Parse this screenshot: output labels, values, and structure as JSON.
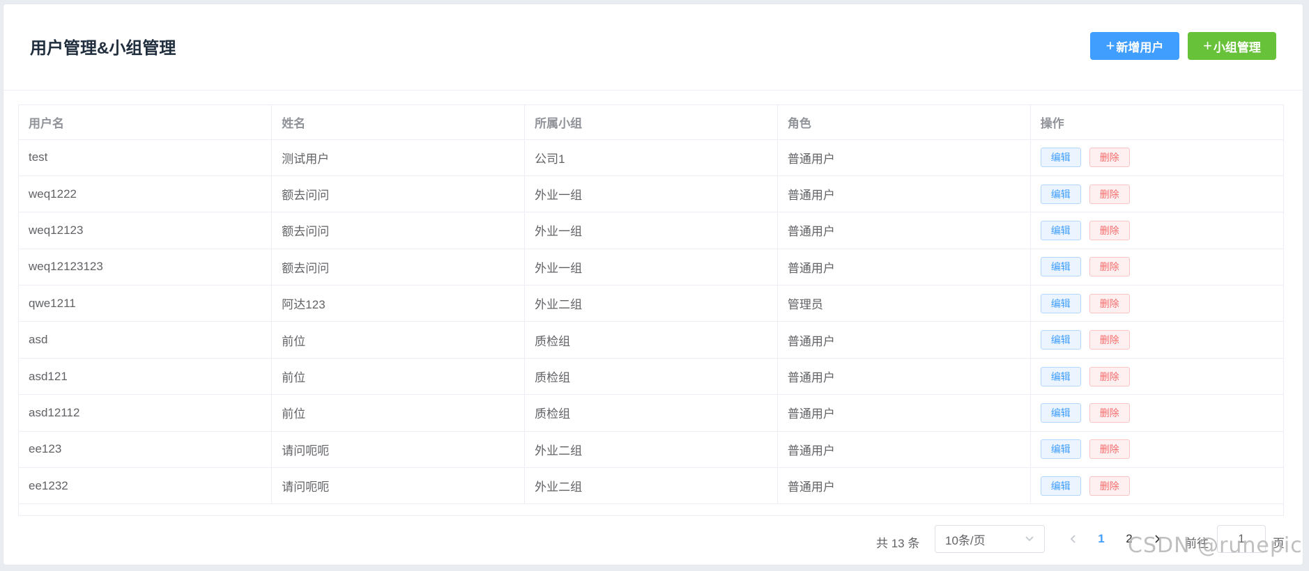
{
  "header": {
    "title": "用户管理&小组管理",
    "add_user_label": "新增用户",
    "group_manage_label": "小组管理",
    "plus": "+"
  },
  "table": {
    "columns": [
      "用户名",
      "姓名",
      "所属小组",
      "角色",
      "操作"
    ],
    "rows": [
      {
        "username": "test",
        "name": "测试用户",
        "group": "公司1",
        "role": "普通用户"
      },
      {
        "username": "weq1222",
        "name": "额去问问",
        "group": "外业一组",
        "role": "普通用户"
      },
      {
        "username": "weq12123",
        "name": "额去问问",
        "group": "外业一组",
        "role": "普通用户"
      },
      {
        "username": "weq12123123",
        "name": "额去问问",
        "group": "外业一组",
        "role": "普通用户"
      },
      {
        "username": "qwe1211",
        "name": "阿达123",
        "group": "外业二组",
        "role": "管理员"
      },
      {
        "username": "asd",
        "name": "前位",
        "group": "质检组",
        "role": "普通用户"
      },
      {
        "username": "asd121",
        "name": "前位",
        "group": "质检组",
        "role": "普通用户"
      },
      {
        "username": "asd12112",
        "name": "前位",
        "group": "质检组",
        "role": "普通用户"
      },
      {
        "username": "ee123",
        "name": "请问呃呃",
        "group": "外业二组",
        "role": "普通用户"
      },
      {
        "username": "ee1232",
        "name": "请问呃呃",
        "group": "外业二组",
        "role": "普通用户"
      }
    ],
    "edit_label": "编辑",
    "delete_label": "删除"
  },
  "pagination": {
    "total_text": "共 13 条",
    "page_size": "10条/页",
    "pages": [
      "1",
      "2"
    ],
    "current_page": "1",
    "goto_label": "前往",
    "goto_value": "1",
    "page_suffix": "页"
  },
  "watermark": "CSDN @runepic",
  "colors": {
    "primary": "#409eff",
    "success": "#67c23a",
    "danger": "#f56c6c"
  }
}
